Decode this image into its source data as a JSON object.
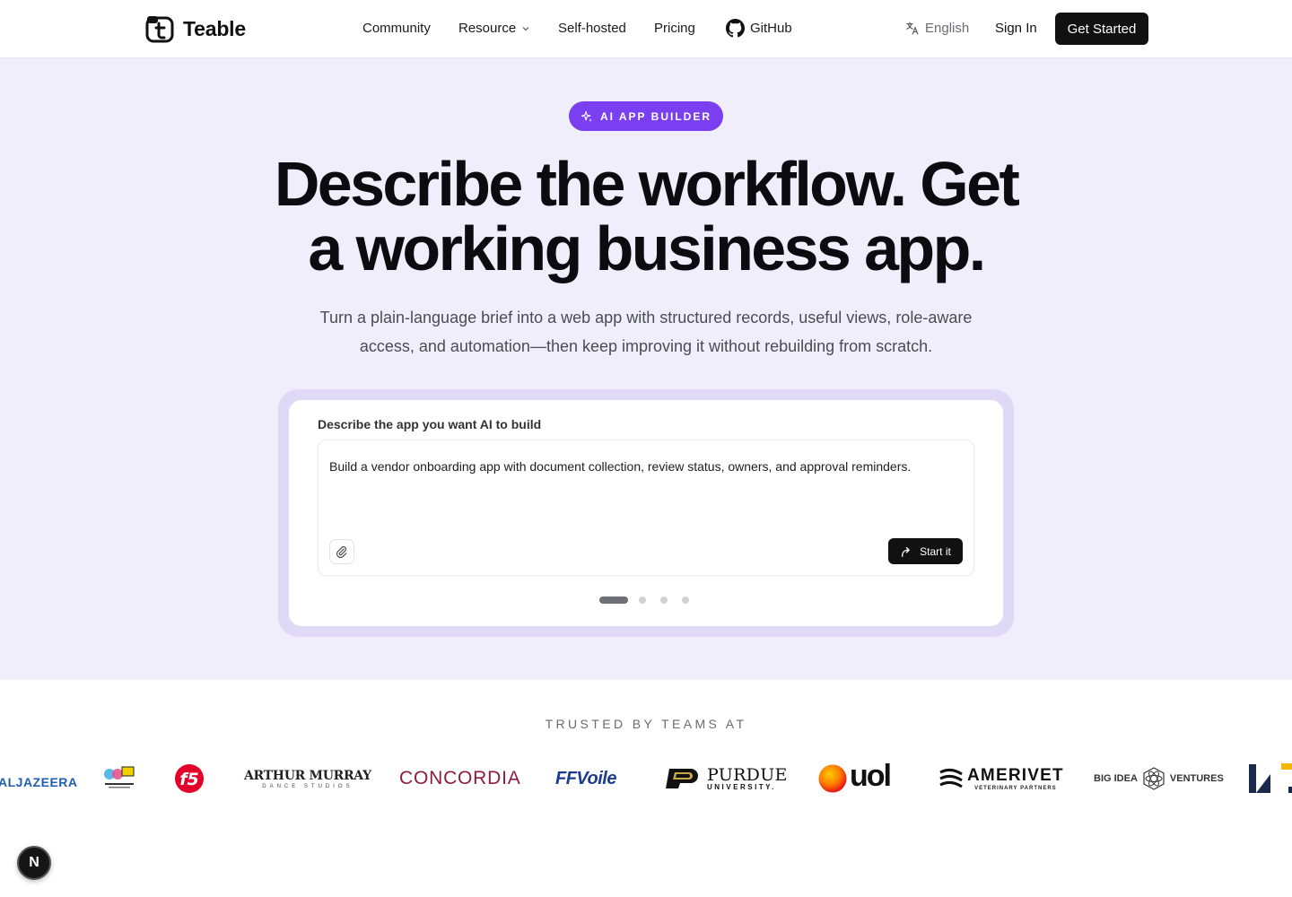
{
  "header": {
    "brand": "Teable",
    "nav": [
      {
        "label": "Community"
      },
      {
        "label": "Resource"
      },
      {
        "label": "Self-hosted"
      },
      {
        "label": "Pricing"
      },
      {
        "label": "GitHub"
      }
    ],
    "language": "English",
    "sign_in": "Sign In",
    "cta": "Get Started"
  },
  "hero": {
    "badge": "AI APP BUILDER",
    "headline_line1": "Describe the workflow. Get",
    "headline_line2": "a working business app.",
    "subline_line1": "Turn a plain-language brief into a web app with structured records, useful views, role-aware",
    "subline_line2": "access, and automation—then keep improving it without rebuilding from scratch.",
    "prompt_label": "Describe the app you want AI to build",
    "prompt_text": "Build a vendor onboarding app with document collection, review status, owners, and approval reminders.",
    "start_button": "Start it",
    "carousel_total": 4,
    "carousel_active": 1
  },
  "trusted": {
    "title": "TRUSTED BY TEAMS AT",
    "logos": [
      {
        "name": "ALJAZEERA",
        "color": "#1f5fb0"
      },
      {
        "name": "DRAW MUSEUM",
        "color": "#333333"
      },
      {
        "name": "f5",
        "color": "#e4002b"
      },
      {
        "name": "ARTHUR MURRAY",
        "sub": "DANCE STUDIOS",
        "color": "#222222"
      },
      {
        "name": "CONCORDIA",
        "color": "#8c1d40"
      },
      {
        "name": "FFVoile",
        "color": "#1d3c8f"
      },
      {
        "name": "PURDUE",
        "sub": "UNIVERSITY.",
        "color": "#111111"
      },
      {
        "name": "uol",
        "color": "#111111"
      },
      {
        "name": "AMERIVET",
        "sub": "VETERINARY PARTNERS",
        "color": "#111111"
      },
      {
        "name": "BIG IDEA",
        "name2": "VENTURES",
        "color": "#333333"
      }
    ]
  },
  "colors": {
    "accent": "#7a3ff0",
    "hero_bg": "#f0eefb",
    "card_border": "#e0d8f7",
    "dark": "#111111"
  },
  "fab_letter": "N"
}
